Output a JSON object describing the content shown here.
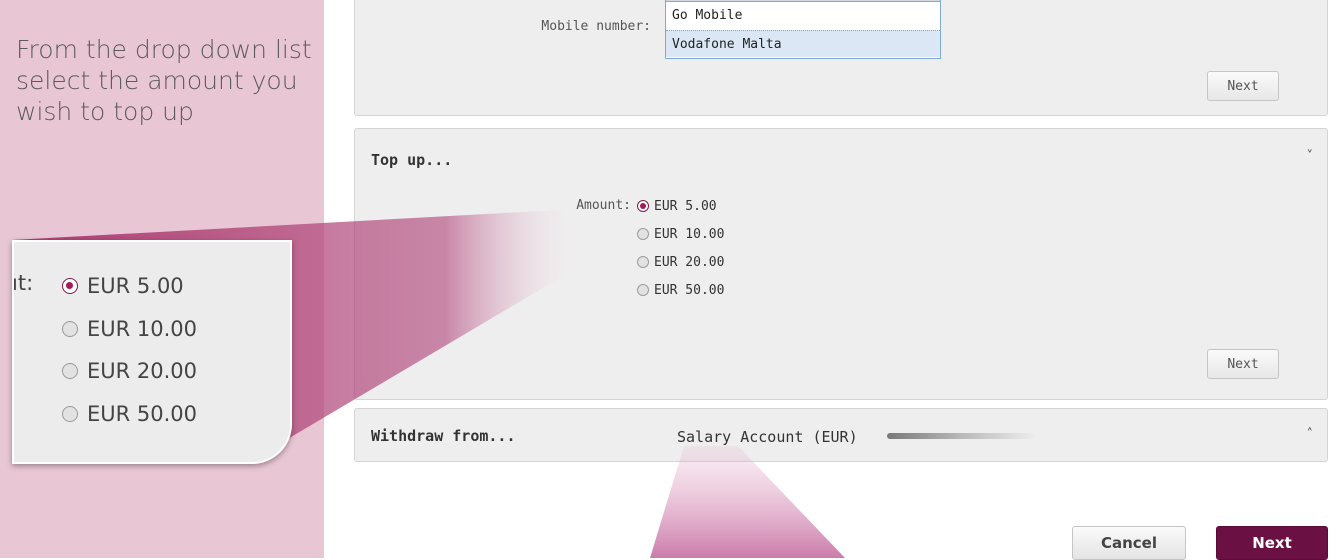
{
  "tutorial": {
    "step_text": "From the drop down list select the amount you wish to top up",
    "zoom_label_fragment": "ıt:",
    "zoom_options": [
      "EUR 5.00",
      "EUR 10.00",
      "EUR 20.00",
      "EUR 50.00"
    ]
  },
  "provider_section": {
    "mobile_number_label": "Mobile number:",
    "dropdown_options": [
      "Go Mobile",
      "Vodafone Malta"
    ],
    "next_label": "Next"
  },
  "topup_section": {
    "title": "Top up...",
    "amount_label": "Amount:",
    "options": [
      "EUR 5.00",
      "EUR 10.00",
      "EUR 20.00",
      "EUR 50.00"
    ],
    "selected": "EUR 5.00",
    "next_label": "Next",
    "chevron": "chevron-down-icon"
  },
  "withdraw_section": {
    "title": "Withdraw from...",
    "value": "Salary Account (EUR)",
    "chevron": "chevron-up-icon"
  },
  "footer": {
    "cancel_label": "Cancel",
    "next_label": "Next"
  },
  "colors": {
    "accent": "#6b1042",
    "callout_pink": "#e9c6d3",
    "panel_bg": "#eeeeee"
  }
}
